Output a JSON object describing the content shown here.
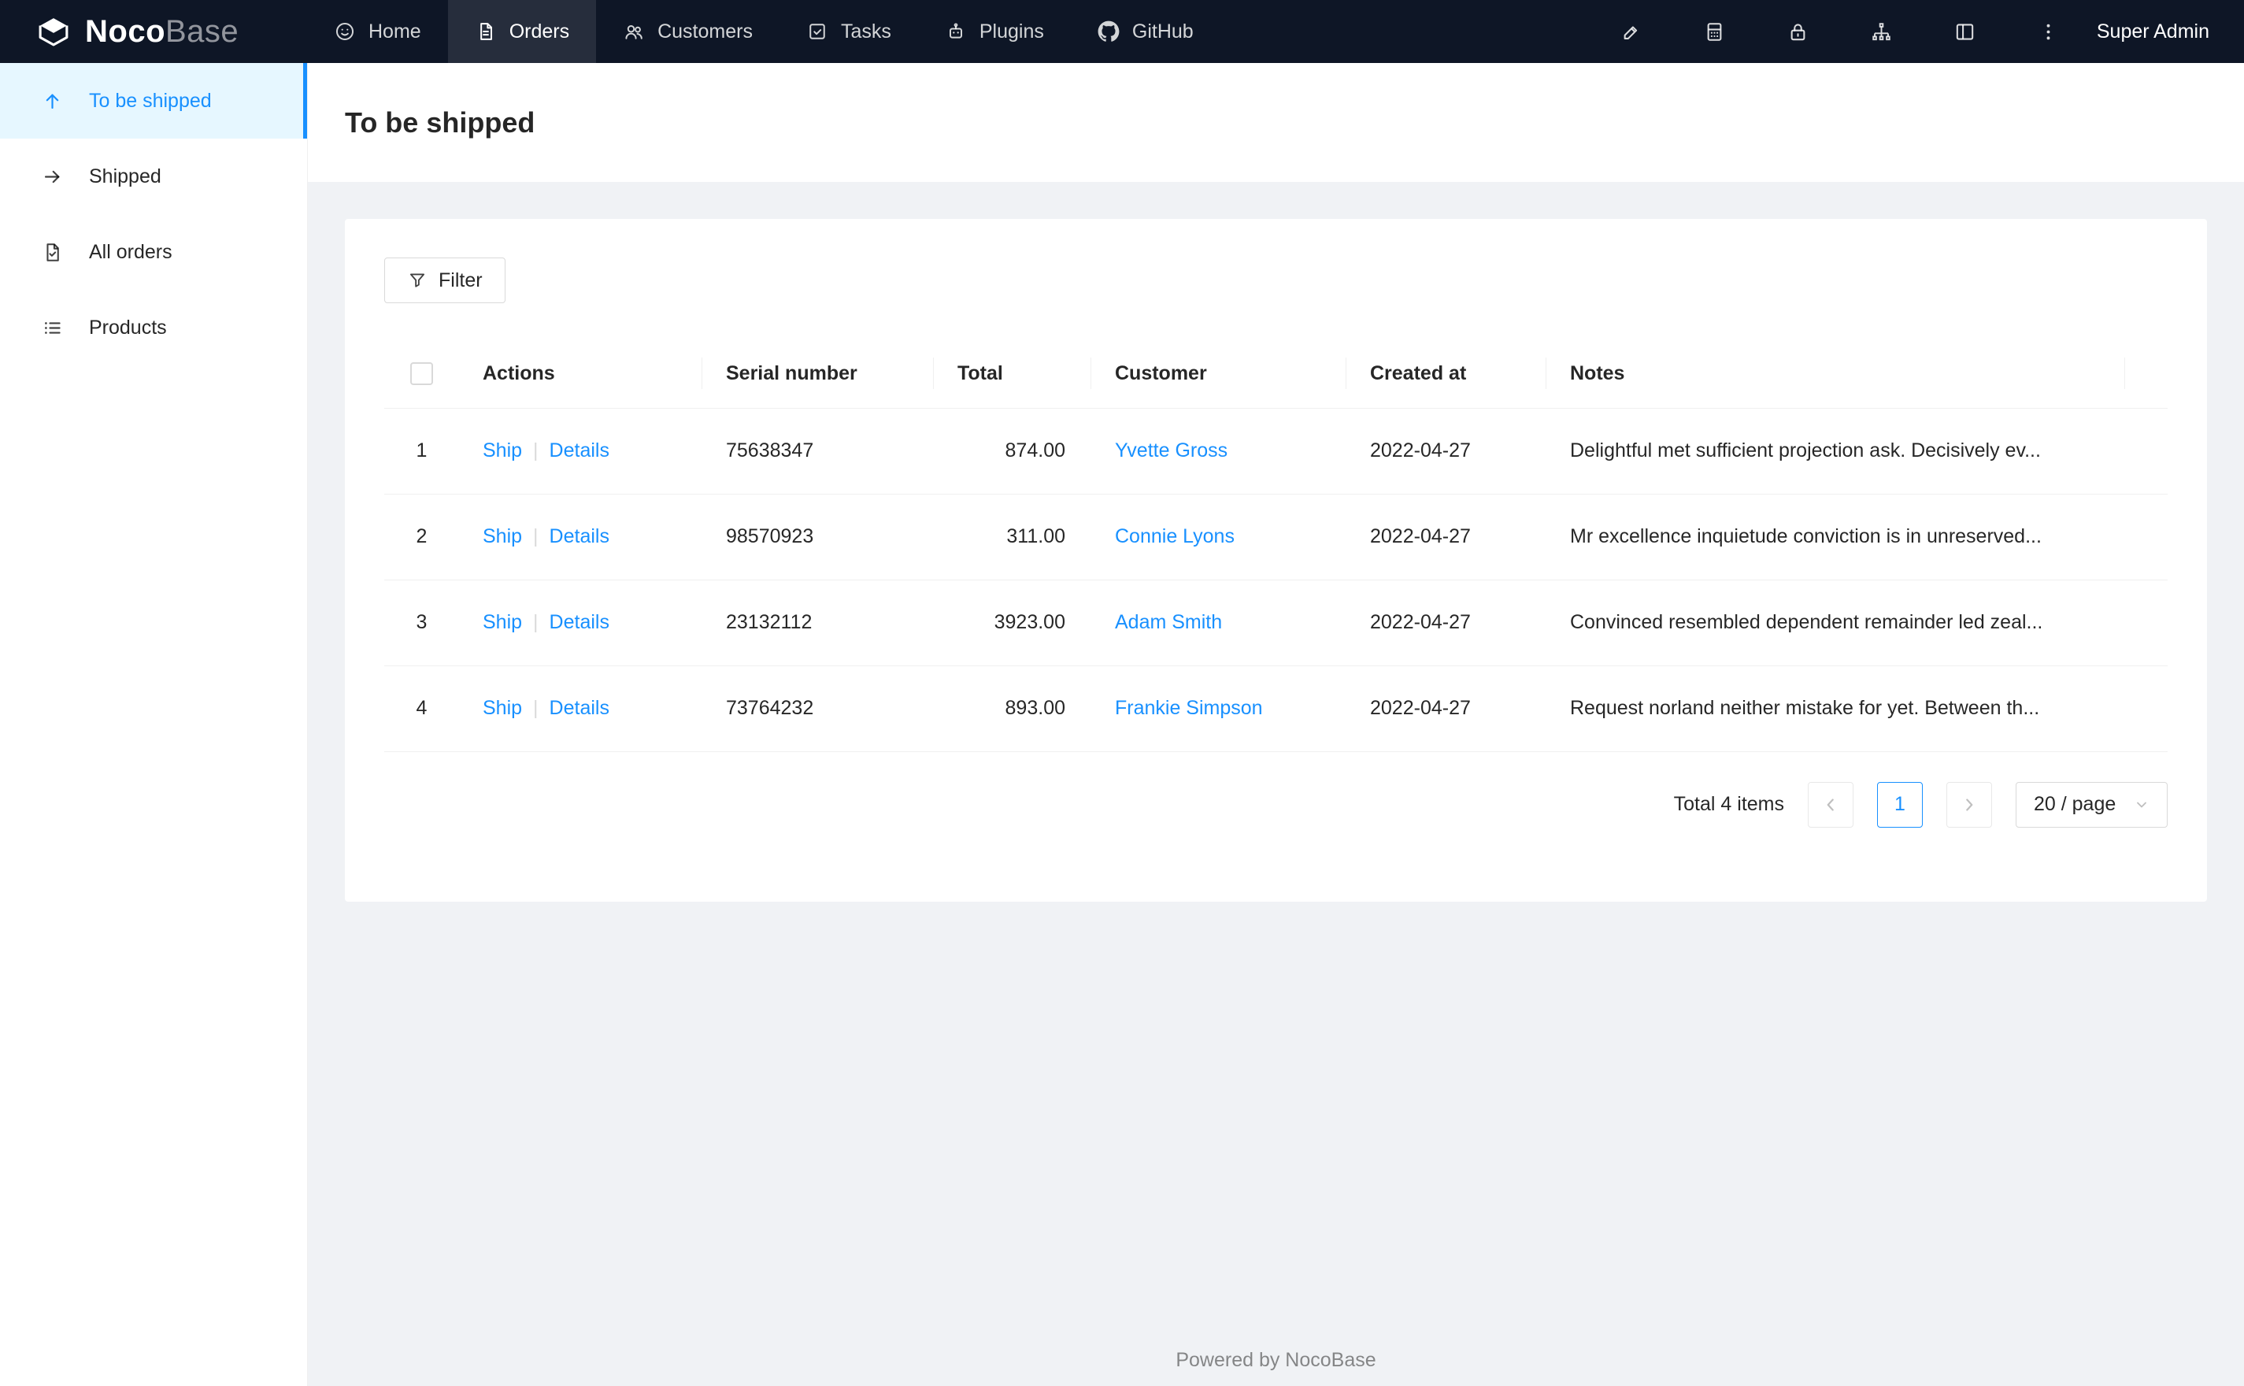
{
  "navbar": {
    "logo": {
      "noco": "Noco",
      "base": "Base"
    },
    "items": [
      {
        "label": "Home"
      },
      {
        "label": "Orders"
      },
      {
        "label": "Customers"
      },
      {
        "label": "Tasks"
      },
      {
        "label": "Plugins"
      },
      {
        "label": "GitHub"
      }
    ],
    "user": "Super Admin"
  },
  "sidebar": {
    "items": [
      {
        "label": "To be shipped"
      },
      {
        "label": "Shipped"
      },
      {
        "label": "All orders"
      },
      {
        "label": "Products"
      }
    ]
  },
  "page": {
    "title": "To be shipped"
  },
  "toolbar": {
    "filter_label": "Filter"
  },
  "table": {
    "headers": {
      "actions": "Actions",
      "serial": "Serial number",
      "total": "Total",
      "customer": "Customer",
      "created": "Created at",
      "notes": "Notes"
    },
    "actions": {
      "ship": "Ship",
      "details": "Details"
    },
    "rows": [
      {
        "index": "1",
        "serial": "75638347",
        "total": "874.00",
        "customer": "Yvette Gross",
        "created": "2022-04-27",
        "notes": "Delightful met sufficient projection ask. Decisively ev..."
      },
      {
        "index": "2",
        "serial": "98570923",
        "total": "311.00",
        "customer": "Connie Lyons",
        "created": "2022-04-27",
        "notes": "Mr excellence inquietude conviction is in unreserved..."
      },
      {
        "index": "3",
        "serial": "23132112",
        "total": "3923.00",
        "customer": "Adam Smith",
        "created": "2022-04-27",
        "notes": "Convinced resembled dependent remainder led zeal..."
      },
      {
        "index": "4",
        "serial": "73764232",
        "total": "893.00",
        "customer": "Frankie Simpson",
        "created": "2022-04-27",
        "notes": "Request norland neither mistake for yet. Between th..."
      }
    ]
  },
  "pagination": {
    "total_text": "Total 4 items",
    "page": "1",
    "page_size": "20 / page"
  },
  "footer": {
    "text": "Powered by NocoBase"
  },
  "colors": {
    "accent": "#1890ff",
    "navbar_bg": "#0e1626",
    "sidebar_active_bg": "#e6f7ff",
    "body_bg": "#f0f2f5",
    "link": "#1890ff"
  }
}
